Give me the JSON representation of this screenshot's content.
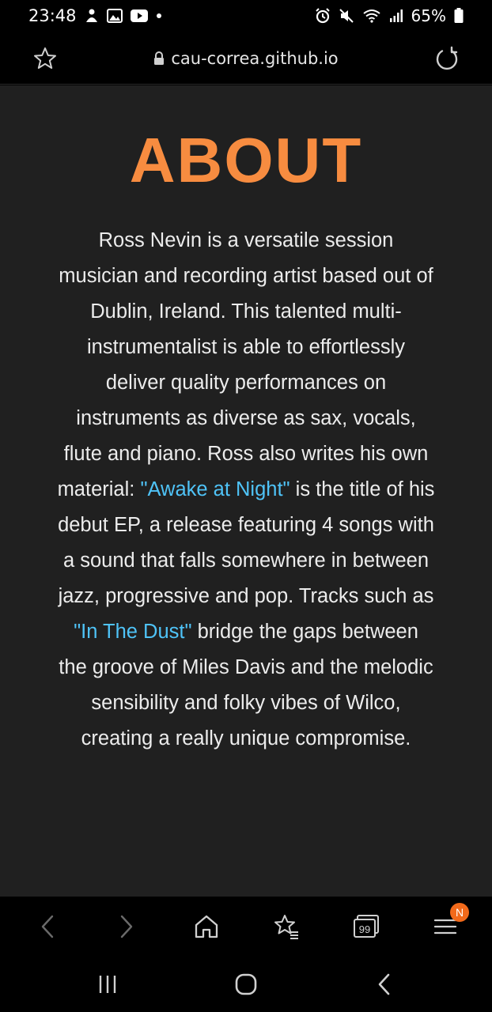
{
  "status_bar": {
    "time": "23:48",
    "battery": "65%"
  },
  "browser": {
    "url": "cau-correa.github.io",
    "tabs_count": "99",
    "menu_badge": "N"
  },
  "about": {
    "title": "ABOUT",
    "text_1": "Ross Nevin is a versatile session musician and recording artist based out of Dublin, Ireland. This talented multi-instrumentalist is able to effortlessly deliver quality performances on instruments as diverse as sax, vocals, flute and piano. Ross also writes his own material: ",
    "link_1": "\"Awake at Night\"",
    "text_2": " is the title of his debut EP, a release featuring 4 songs with a sound that falls somewhere in between jazz, progressive and pop. Tracks such as ",
    "link_2": "\"In The Dust\"",
    "text_3": " bridge the gaps between the groove of Miles Davis and the melodic sensibility and folky vibes of Wilco, creating a really unique compromise."
  },
  "colors": {
    "accent": "#f78c40",
    "link": "#4fc3f7",
    "background": "#202020",
    "badge": "#f26a1b"
  },
  "icons": {
    "status": [
      "person-notification-icon",
      "image-icon",
      "youtube-icon",
      "dot-icon",
      "alarm-icon",
      "mute-icon",
      "wifi-icon",
      "signal-icon",
      "battery-icon"
    ],
    "toolbar": [
      "bookmark-star-icon",
      "lock-icon",
      "reload-icon"
    ],
    "nav": [
      "back-arrow-icon",
      "forward-arrow-icon",
      "home-icon",
      "bookmarks-icon",
      "tabs-icon",
      "menu-icon"
    ],
    "system": [
      "recents-icon",
      "home-button-icon",
      "system-back-icon"
    ]
  }
}
